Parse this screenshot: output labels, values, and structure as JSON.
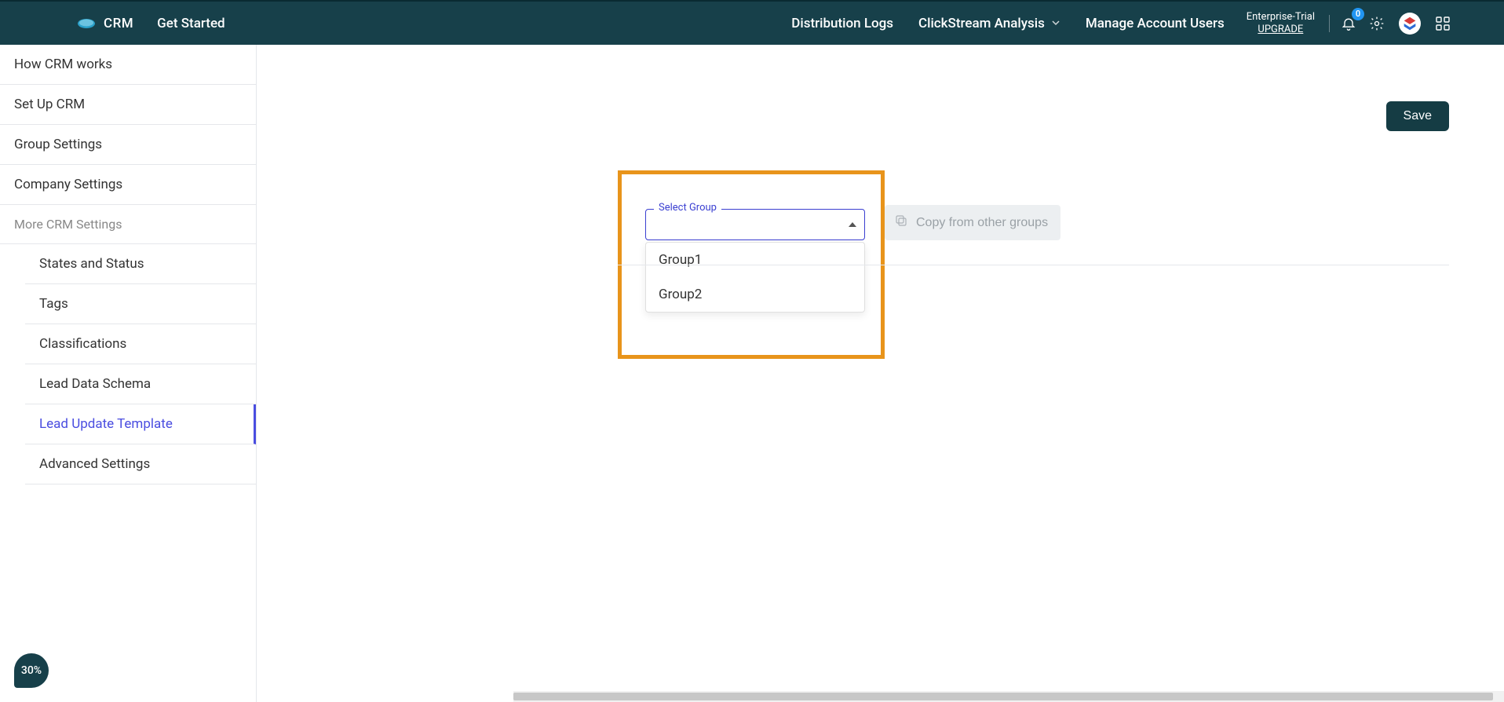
{
  "header": {
    "logo_text": "CRM",
    "get_started": "Get Started",
    "nav": {
      "distribution_logs": "Distribution Logs",
      "clickstream": "ClickStream Analysis",
      "manage_users": "Manage Account Users"
    },
    "trial": {
      "label": "Enterprise-Trial",
      "upgrade": "UPGRADE"
    },
    "notification_count": "0"
  },
  "sidebar": {
    "top": [
      "How CRM works",
      "Set Up CRM",
      "Group Settings",
      "Company Settings"
    ],
    "section_label": "More CRM Settings",
    "sub": [
      "States and Status",
      "Tags",
      "Classifications",
      "Lead Data Schema",
      "Lead Update Template",
      "Advanced Settings"
    ],
    "active_index": 4
  },
  "main": {
    "save_label": "Save",
    "select_label": "Select Group",
    "options": [
      "Group1",
      "Group2"
    ],
    "copy_label": "Copy from other groups"
  },
  "progress": "30%"
}
